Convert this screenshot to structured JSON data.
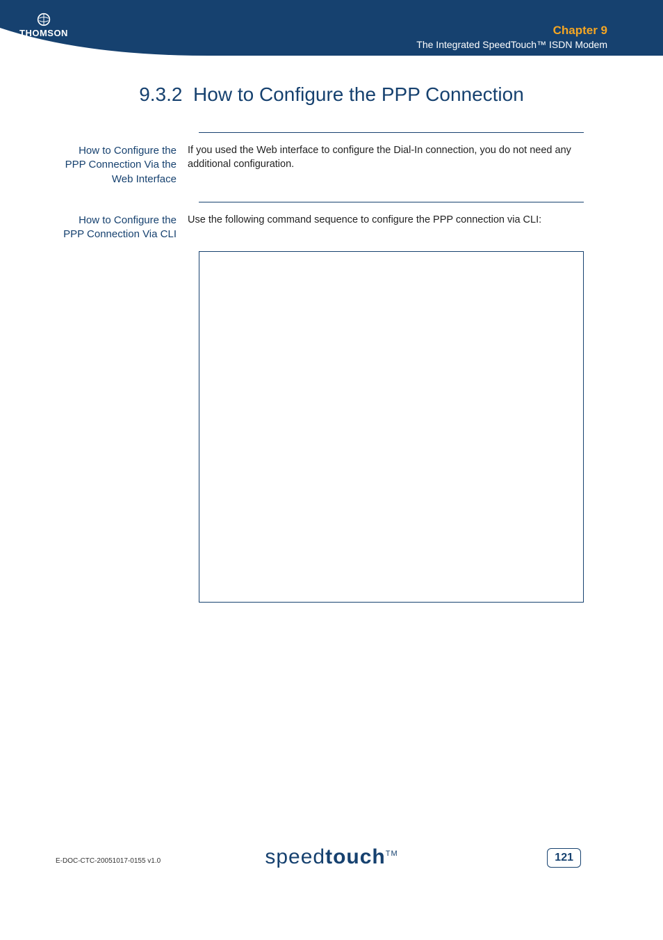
{
  "header": {
    "brand": "THOMSON",
    "chapter": "Chapter 9",
    "subtitle": "The Integrated SpeedTouch™ ISDN Modem"
  },
  "section": {
    "number": "9.3.2",
    "title": "How to Configure the PPP Connection"
  },
  "blocks": {
    "web": {
      "label": "How to Configure the PPP Connection Via the Web Interface",
      "body": "If you used the Web interface to configure the Dial-In connection, you do not need any additional configuration."
    },
    "cli": {
      "label": "How to Configure the PPP Connection Via CLI",
      "body": "Use the following command sequence to configure the PPP connection via CLI:"
    }
  },
  "footer": {
    "doc_id": "E-DOC-CTC-20051017-0155 v1.0",
    "product_light": "speed",
    "product_bold": "touch",
    "tm": "TM",
    "page": "121"
  }
}
